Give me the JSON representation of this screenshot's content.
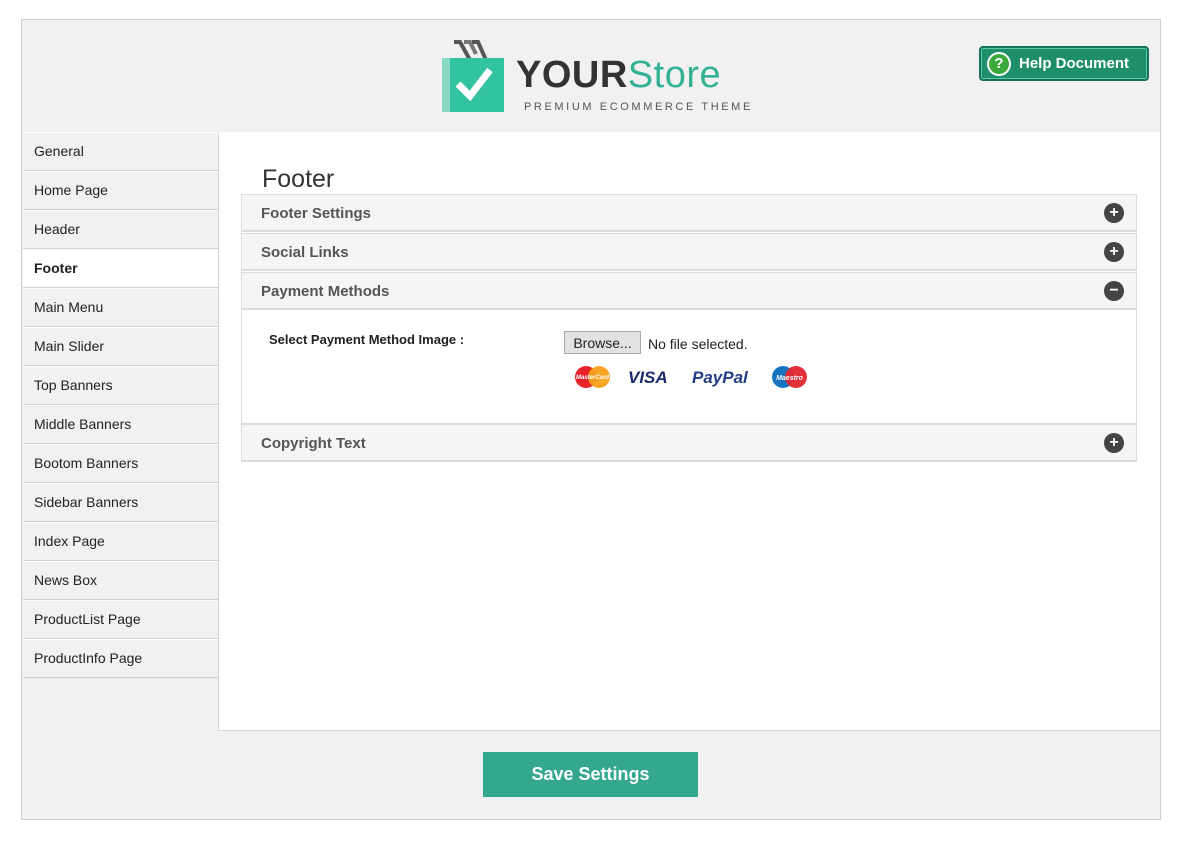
{
  "header": {
    "logo_your": "YOUR",
    "logo_store": "Store",
    "logo_tagline": "PREMIUM ECOMMERCE THEME",
    "help_label": "Help Document",
    "help_icon": "?"
  },
  "sidebar": {
    "items": [
      {
        "label": "General"
      },
      {
        "label": "Home Page"
      },
      {
        "label": "Header"
      },
      {
        "label": "Footer",
        "active": true
      },
      {
        "label": "Main Menu"
      },
      {
        "label": "Main Slider"
      },
      {
        "label": "Top Banners"
      },
      {
        "label": "Middle Banners"
      },
      {
        "label": "Bootom Banners"
      },
      {
        "label": "Sidebar Banners"
      },
      {
        "label": "Index Page"
      },
      {
        "label": "News Box"
      },
      {
        "label": "ProductList Page"
      },
      {
        "label": "ProductInfo Page"
      }
    ]
  },
  "main": {
    "title": "Footer",
    "sections": [
      {
        "label": "Footer Settings",
        "toggle": "+"
      },
      {
        "label": "Social Links",
        "toggle": "+"
      },
      {
        "label": "Payment Methods",
        "toggle": "−"
      },
      {
        "label": "Copyright Text",
        "toggle": "+"
      }
    ],
    "payment": {
      "field_label": "Select Payment Method Image :",
      "browse_label": "Browse...",
      "file_status": "No file selected.",
      "cards": {
        "mastercard": "MasterCard",
        "visa": "VISA",
        "paypal": "PayPal",
        "maestro": "Maestro"
      }
    }
  },
  "footer": {
    "save_label": "Save Settings"
  },
  "colors": {
    "accent": "#34a88e",
    "brand_green": "#32b196",
    "help_green": "#1e8f6a"
  }
}
